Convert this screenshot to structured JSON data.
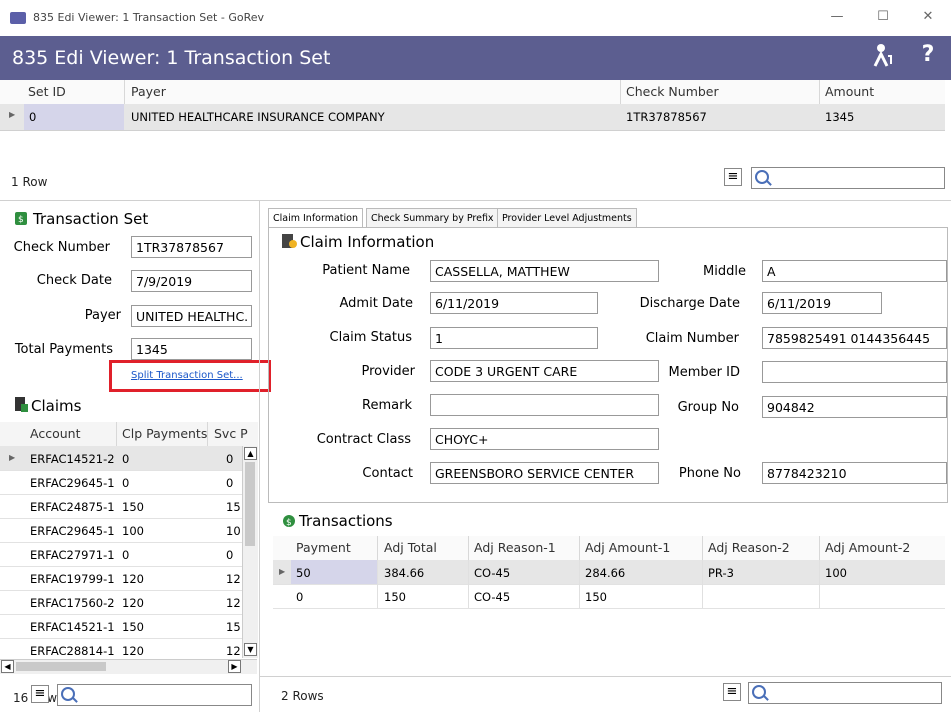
{
  "window": {
    "title": "835 Edi Viewer: 1 Transaction Set - GoRev",
    "minimize": "—",
    "maximize": "☐",
    "close": "✕"
  },
  "header": {
    "title": "835 Edi Viewer: 1 Transaction Set",
    "help": "?"
  },
  "top_grid": {
    "columns": [
      "Set ID",
      "Payer",
      "Check Number",
      "Amount"
    ],
    "row": {
      "set_id": "0",
      "payer": "UNITED HEALTHCARE INSURANCE COMPANY",
      "check_number": "1TR37878567",
      "amount": "1345"
    },
    "status": "1 Row",
    "search_placeholder": ""
  },
  "transaction_set": {
    "title": "Transaction Set",
    "check_number_label": "Check Number",
    "check_number": "1TR37878567",
    "check_date_label": "Check Date",
    "check_date": "7/9/2019",
    "payer_label": "Payer",
    "payer": "UNITED HEALTHC.",
    "total_payments_label": "Total Payments",
    "total_payments": "1345",
    "split_link": "Split Transaction Set..."
  },
  "claims": {
    "title": "Claims",
    "columns": [
      "Account",
      "Clp Payments",
      "Svc P"
    ],
    "rows": [
      [
        "ERFAC14521-2",
        "0",
        "0"
      ],
      [
        "ERFAC29645-1",
        "0",
        "0"
      ],
      [
        "ERFAC24875-1",
        "150",
        "15"
      ],
      [
        "ERFAC29645-1",
        "100",
        "10"
      ],
      [
        "ERFAC27971-1",
        "0",
        "0"
      ],
      [
        "ERFAC19799-1",
        "120",
        "12"
      ],
      [
        "ERFAC17560-2",
        "120",
        "12"
      ],
      [
        "ERFAC14521-1",
        "150",
        "15"
      ],
      [
        "ERFAC28814-1",
        "120",
        "12"
      ]
    ],
    "status": "16 Rows"
  },
  "tabs": [
    "Claim Information",
    "Check Summary by Prefix",
    "Provider Level Adjustments"
  ],
  "claim_info": {
    "title": "Claim Information",
    "patient_name_label": "Patient Name",
    "patient_name": "CASSELLA, MATTHEW",
    "middle_label": "Middle",
    "middle": "A",
    "admit_date_label": "Admit Date",
    "admit_date": "6/11/2019",
    "discharge_date_label": "Discharge Date",
    "discharge_date": "6/11/2019",
    "claim_status_label": "Claim Status",
    "claim_status": "1",
    "claim_number_label": "Claim Number",
    "claim_number": "7859825491 0144356445",
    "provider_label": "Provider",
    "provider": "CODE 3 URGENT CARE",
    "member_id_label": "Member ID",
    "member_id": "",
    "remark_label": "Remark",
    "remark": "",
    "group_no_label": "Group No",
    "group_no": "904842",
    "contract_class_label": "Contract Class",
    "contract_class": "CHOYC+",
    "contact_label": "Contact",
    "contact": "GREENSBORO SERVICE CENTER",
    "phone_no_label": "Phone No",
    "phone_no": "8778423210"
  },
  "transactions": {
    "title": "Transactions",
    "columns": [
      "Payment",
      "Adj Total",
      "Adj Reason-1",
      "Adj Amount-1",
      "Adj Reason-2",
      "Adj Amount-2"
    ],
    "rows": [
      [
        "50",
        "384.66",
        "CO-45",
        "284.66",
        "PR-3",
        "100"
      ],
      [
        "0",
        "150",
        "CO-45",
        "150",
        "",
        ""
      ]
    ],
    "status": "2 Rows"
  },
  "colors": {
    "header_bg": "#5c5e90",
    "selection": "#d5d5ea",
    "highlight_box": "#e0202a",
    "link": "#1a56c8"
  },
  "icons": [
    "app-icon",
    "key-user-icon",
    "help-icon",
    "dollar-icon",
    "claims-icon",
    "claim-info-icon",
    "transactions-icon",
    "menu-icon",
    "search-icon"
  ]
}
